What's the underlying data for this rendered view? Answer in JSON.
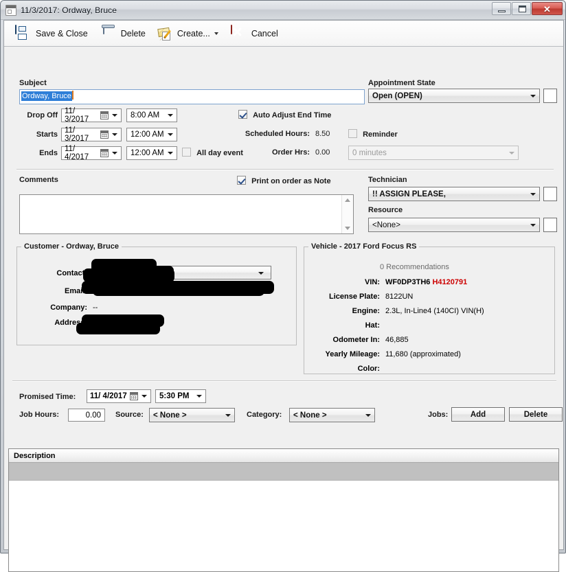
{
  "window": {
    "title": "11/3/2017: Ordway, Bruce",
    "icon": "calendar-icon",
    "minimize": "–",
    "maximize": "□",
    "close": "✕"
  },
  "toolbar": {
    "save_close": "Save & Close",
    "delete": "Delete",
    "create": "Create...",
    "cancel": "Cancel"
  },
  "subject": {
    "label": "Subject",
    "value": "Ordway, Bruce"
  },
  "appointment_state": {
    "label": "Appointment State",
    "value": "Open (OPEN)"
  },
  "schedule": {
    "drop_off_label": "Drop Off",
    "drop_off_date": "11/  3/2017",
    "drop_off_time": "8:00 AM",
    "starts_label": "Starts",
    "starts_date": "11/  3/2017",
    "starts_time": "12:00 AM",
    "ends_label": "Ends",
    "ends_date": "11/  4/2017",
    "ends_time": "12:00 AM",
    "all_day_label": "All day event",
    "auto_adjust_label": "Auto Adjust End Time",
    "scheduled_hours_label": "Scheduled Hours:",
    "scheduled_hours_value": "8.50",
    "order_hrs_label": "Order Hrs:",
    "order_hrs_value": "0.00",
    "reminder_label": "Reminder",
    "reminder_value": "0 minutes"
  },
  "comments": {
    "label": "Comments",
    "print_note_label": "Print on order as Note",
    "value": ""
  },
  "technician": {
    "label": "Technician",
    "value": "!! ASSIGN PLEASE,"
  },
  "resource": {
    "label": "Resource",
    "value": "<None>"
  },
  "customer": {
    "legend": "Customer - Ordway, Bruce",
    "fields": [
      {
        "label": "Contact:",
        "value": "",
        "redacted": true
      },
      {
        "label": "Email:",
        "value": "",
        "redacted": true
      },
      {
        "label": "Company:",
        "value": "--",
        "redacted": false
      },
      {
        "label": "Address:",
        "value": "",
        "redacted": true
      }
    ]
  },
  "vehicle": {
    "legend": "Vehicle - 2017 Ford Focus RS",
    "recommendations": "0 Recommendations",
    "vin_label": "VIN:",
    "vin_prefix": "WF0DP3TH6",
    "vin_suffix": "H4120791",
    "vin_suffix_color": "#cc0000",
    "fields": [
      {
        "label": "License Plate:",
        "value": "8122UN"
      },
      {
        "label": "Engine:",
        "value": "2.3L, In-Line4 (140CI) VIN(H)"
      },
      {
        "label": "Hat:",
        "value": ""
      },
      {
        "label": "Odometer In:",
        "value": "46,885"
      },
      {
        "label": "Yearly Mileage:",
        "value": "11,680 (approximated)"
      },
      {
        "label": "Color:",
        "value": ""
      }
    ]
  },
  "footer": {
    "promised_time_label": "Promised Time:",
    "promised_date": "11/  4/2017",
    "promised_time": "5:30 PM",
    "job_hours_label": "Job Hours:",
    "job_hours_value": "0.00",
    "source_label": "Source:",
    "source_value": "< None >",
    "category_label": "Category:",
    "category_value": "< None >",
    "jobs_label": "Jobs:",
    "add_button": "Add",
    "delete_button": "Delete"
  },
  "grid": {
    "column_description": "Description",
    "rows": []
  }
}
